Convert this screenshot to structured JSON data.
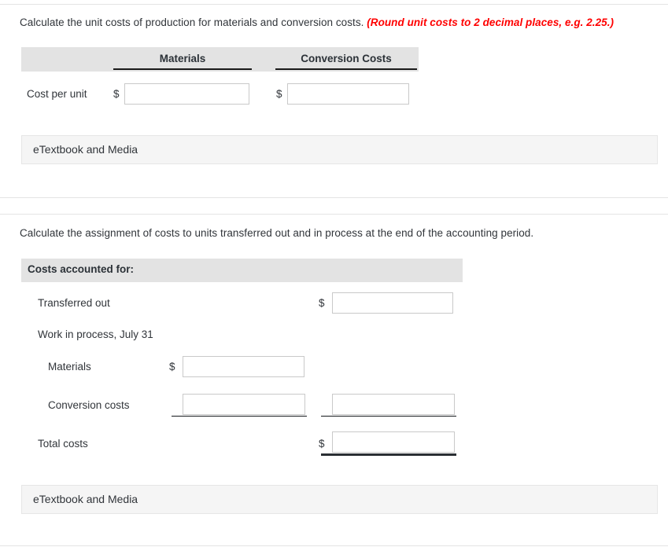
{
  "section1": {
    "prompt": "Calculate the unit costs of production for materials and conversion costs.",
    "hint": "(Round unit costs to 2 decimal places, e.g. 2.25.)",
    "columns": [
      "Materials",
      "Conversion Costs"
    ],
    "row_label": "Cost per unit",
    "currency_symbol": "$",
    "inputs": [
      {
        "name": "cost-per-unit-materials",
        "value": "",
        "placeholder": ""
      },
      {
        "name": "cost-per-unit-conversion",
        "value": "",
        "placeholder": ""
      }
    ],
    "etextbook_label": "eTextbook and Media"
  },
  "section2": {
    "prompt": "Calculate the assignment of costs to units transferred out and in process at the end of the accounting period.",
    "table_header": "Costs accounted for:",
    "currency_symbol": "$",
    "rows": [
      {
        "label": "Transferred out"
      },
      {
        "label": "Work in process, July 31"
      },
      {
        "label": "Materials"
      },
      {
        "label": "Conversion costs"
      },
      {
        "label": "Total costs"
      }
    ],
    "inputs": [
      {
        "name": "transferred-out-amount",
        "value": "",
        "placeholder": ""
      },
      {
        "name": "wip-materials-amount",
        "value": "",
        "placeholder": ""
      },
      {
        "name": "wip-conversion-amount",
        "value": "",
        "placeholder": ""
      },
      {
        "name": "wip-subtotal-amount",
        "value": "",
        "placeholder": ""
      },
      {
        "name": "total-costs-amount",
        "value": "",
        "placeholder": ""
      }
    ],
    "etextbook_label": "eTextbook and Media"
  },
  "colors": {
    "hint_red": "#ff0000",
    "header_band": "#e3e3e3",
    "etextbook_band": "#f5f5f5",
    "text": "#31353a",
    "rule": "#e4e4e4"
  }
}
